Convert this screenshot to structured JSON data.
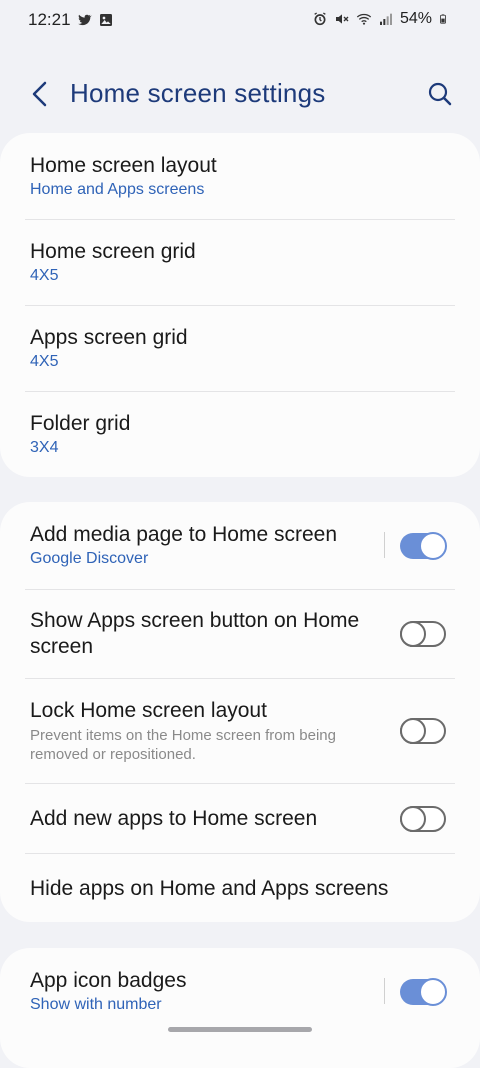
{
  "status_bar": {
    "time": "12:21",
    "battery": "54%",
    "left_icons": [
      "twitter-icon",
      "image-icon"
    ],
    "right_icons": [
      "alarm-icon",
      "mute-icon",
      "wifi-icon",
      "signal-icon",
      "battery-icon"
    ]
  },
  "header": {
    "title": "Home screen settings"
  },
  "layout_card": {
    "items": [
      {
        "label": "Home screen layout",
        "sub": "Home and Apps screens"
      },
      {
        "label": "Home screen grid",
        "sub": "4X5"
      },
      {
        "label": "Apps screen grid",
        "sub": "4X5"
      },
      {
        "label": "Folder grid",
        "sub": "3X4"
      }
    ]
  },
  "options_card": {
    "items": [
      {
        "label": "Add media page to Home screen",
        "sub": "Google Discover",
        "toggle": "on"
      },
      {
        "label_line1": "Show Apps screen button on Home",
        "label_line2": "screen",
        "toggle": "off"
      },
      {
        "label": "Lock Home screen layout",
        "desc_line1": "Prevent items on the Home screen from being",
        "desc_line2": "removed or repositioned.",
        "toggle": "off"
      },
      {
        "label": "Add new apps to Home screen",
        "toggle": "off"
      },
      {
        "label": "Hide apps on Home and Apps screens"
      }
    ]
  },
  "badges_card": {
    "items": [
      {
        "label": "App icon badges",
        "sub": "Show with number",
        "toggle": "on"
      }
    ]
  },
  "colors": {
    "accent": "#2f63b7",
    "title": "#1d3a7a",
    "toggle_on": "#6a8fd7",
    "background": "#f1f2f6",
    "card": "#fcfcfc"
  }
}
